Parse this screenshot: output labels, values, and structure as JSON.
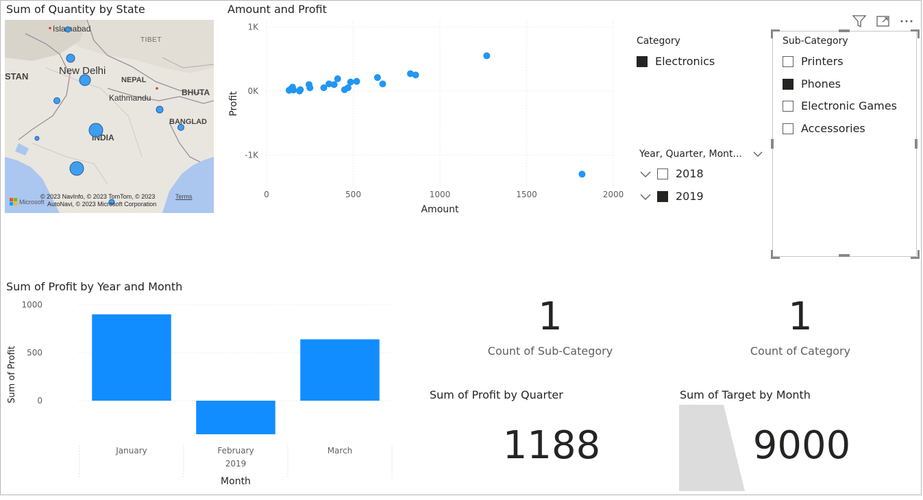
{
  "map": {
    "title": "Sum of Quantity by State",
    "labels": {
      "islamabad": "Islamabad",
      "tibet": "TIBET",
      "stan": "STAN",
      "new_delhi": "New Delhi",
      "nepal": "NEPAL",
      "bhutan": "BHUTA",
      "kathmandu": "Kathmandu",
      "bangladesh": "BANGLAD",
      "india": "INDIA"
    },
    "attribution_1": "© 2023 NavInfo, © 2023 TomTom, © 2023",
    "attribution_2": "AutoNavi, © 2023 Microsoft Corporation",
    "terms_link": "Terms",
    "microsoft_logo_text": "Microsoft"
  },
  "scatter": {
    "title": "Amount and Profit",
    "chart_data": {
      "type": "scatter",
      "title": "Amount and Profit",
      "xlabel": "Amount",
      "ylabel": "Profit",
      "xlim": [
        0,
        2000
      ],
      "ylim": [
        -1500,
        1100
      ],
      "x_ticks": [
        "0",
        "500",
        "1000",
        "1500",
        "2000"
      ],
      "y_ticks": [
        "1K",
        "0K",
        "-1K"
      ],
      "x_tick_values": [
        0,
        500,
        1000,
        1500,
        2000
      ],
      "y_tick_values": [
        1000,
        0,
        -1000
      ],
      "grid": true,
      "color": "#2196f3",
      "points": [
        {
          "x": 130,
          "y": 10
        },
        {
          "x": 140,
          "y": 30
        },
        {
          "x": 150,
          "y": 60
        },
        {
          "x": 155,
          "y": 15
        },
        {
          "x": 190,
          "y": 0
        },
        {
          "x": 195,
          "y": 20
        },
        {
          "x": 245,
          "y": 100
        },
        {
          "x": 250,
          "y": 50
        },
        {
          "x": 330,
          "y": 50
        },
        {
          "x": 360,
          "y": 110
        },
        {
          "x": 390,
          "y": 100
        },
        {
          "x": 410,
          "y": 190
        },
        {
          "x": 450,
          "y": 20
        },
        {
          "x": 470,
          "y": 50
        },
        {
          "x": 485,
          "y": 140
        },
        {
          "x": 520,
          "y": 150
        },
        {
          "x": 640,
          "y": 210
        },
        {
          "x": 670,
          "y": 110
        },
        {
          "x": 830,
          "y": 270
        },
        {
          "x": 860,
          "y": 250
        },
        {
          "x": 1270,
          "y": 550
        },
        {
          "x": 1820,
          "y": -1300
        }
      ]
    }
  },
  "category_legend": {
    "title": "Category",
    "items": [
      {
        "label": "Electronics",
        "color": "#252423"
      }
    ]
  },
  "date_slicer": {
    "title": "Year, Quarter, Mont...",
    "items": [
      {
        "label": "2018",
        "checked": false
      },
      {
        "label": "2019",
        "checked": true
      }
    ]
  },
  "subcategory_slicer": {
    "title": "Sub-Category",
    "items": [
      {
        "label": "Printers",
        "checked": false
      },
      {
        "label": "Phones",
        "checked": true
      },
      {
        "label": "Electronic Games",
        "checked": false
      },
      {
        "label": "Accessories",
        "checked": false
      }
    ],
    "header_icons": [
      "filter-icon",
      "focus-mode-icon",
      "more-options-icon"
    ]
  },
  "bar": {
    "title": "Sum of Profit by Year and Month",
    "chart_data": {
      "type": "bar",
      "title": "Sum of Profit by Year and Month",
      "xlabel": "Month",
      "ylabel": "Sum of Profit",
      "categories": [
        "January",
        "February",
        "March"
      ],
      "group_label": "2019",
      "values": [
        900,
        -350,
        640
      ],
      "ylim": [
        -400,
        1000
      ],
      "y_ticks": [
        "1000",
        "500",
        "0"
      ],
      "y_tick_values": [
        1000,
        500,
        0
      ],
      "color": "#118dff"
    }
  },
  "cards": {
    "count_subcategory": {
      "value": "1",
      "label": "Count of Sub-Category"
    },
    "count_category": {
      "value": "1",
      "label": "Count of Category"
    },
    "profit_by_quarter": {
      "title": "Sum of Profit by Quarter",
      "value": "1188"
    },
    "target_by_month": {
      "title": "Sum of Target by Month",
      "value": "9000",
      "shape_color": "#dcdcdc"
    }
  }
}
